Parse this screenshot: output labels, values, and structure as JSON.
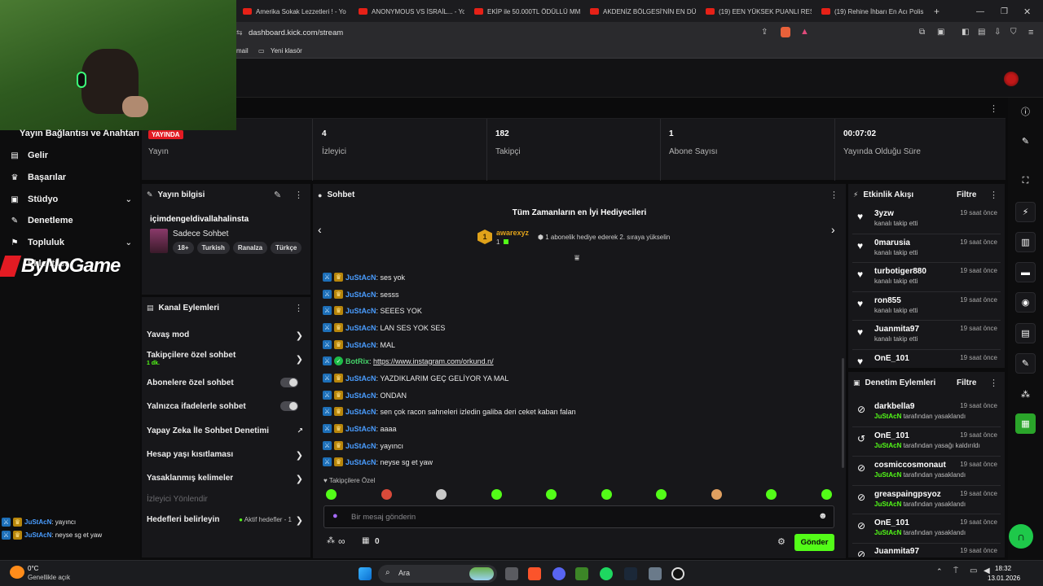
{
  "browser": {
    "tabs": [
      "Amerika Sokak Lezzetleri ! - Yo",
      "ANONYMOUS VS İSRAİL... - Yo",
      "EKİP ile 50.000TL ÖDÜLLÜ MM",
      "AKDENİZ BÖLGESİ'NİN EN DÜ",
      "(19) EEN YÜKSEK PUANLI REST",
      "(19) Rehine İhbarı En Acı Polis"
    ],
    "new_tab": "+",
    "url": "dashboard.kick.com/stream",
    "bookmarks": [
      "mail",
      "Yeni klasör"
    ]
  },
  "overlay": {
    "logo_text": "ByNoGame",
    "partial_heading": "Yayın Bağlantısı ve Anahtarı",
    "chat_lines": [
      {
        "user": "JuStAcN",
        "text": ": yayıncı"
      },
      {
        "user": "JuStAcN",
        "text": ": neyse sg et yaw"
      }
    ]
  },
  "sidebar": {
    "items": [
      {
        "icon": "inbox-icon",
        "label": "Gelir",
        "chevron": false
      },
      {
        "icon": "trophy-icon",
        "label": "Başarılar",
        "chevron": false
      },
      {
        "icon": "studio-icon",
        "label": "Stüdyo",
        "chevron": true
      },
      {
        "icon": "wrench-icon",
        "label": "Denetleme",
        "chevron": false
      },
      {
        "icon": "community-icon",
        "label": "Topluluk",
        "chevron": true
      },
      {
        "icon": "extensions-icon",
        "label": "Eklentiler",
        "chevron": false
      }
    ]
  },
  "stats": {
    "live_badge": "YAYINDA",
    "items": [
      {
        "value": "",
        "label": "Yayın"
      },
      {
        "value": "4",
        "label": "İzleyici"
      },
      {
        "value": "182",
        "label": "Takipçi"
      },
      {
        "value": "1",
        "label": "Abone Sayısı"
      },
      {
        "value": "00:07:02",
        "label": "Yayında Olduğu Süre"
      }
    ]
  },
  "stream_info": {
    "header": "Yayın bilgisi",
    "title": "içimdengeldivallahalinsta",
    "category": "Sadece Sohbet",
    "tags": [
      "18+",
      "Turkish",
      "Ranalza",
      "Türkçe"
    ]
  },
  "channel_actions": {
    "header": "Kanal Eylemleri",
    "slow_mode": "Yavaş mod",
    "followers_only": "Takipçilere özel sohbet",
    "followers_only_sub": "1 dk.",
    "subscribers_only": "Abonelere özel sohbet",
    "emotes_only": "Yalnızca ifadelerle sohbet",
    "ai_moderation": "Yapay Zeka İle Sohbet Denetimi",
    "account_age": "Hesap yaşı kısıtlaması",
    "banned_words": "Yasaklanmış kelimeler",
    "viewer_redirect": "İzleyici Yönlendir",
    "goals": "Hedefleri belirleyin",
    "goals_status": "Aktif hedefler - 1"
  },
  "chat": {
    "header": "Sohbet",
    "gifters_title": "Tüm Zamanların en İyi Hediyecileri",
    "top_gifter": {
      "rank": "1",
      "name": "awarexyz",
      "count": "1"
    },
    "gift_note": "1 abonelik hediye ederek 2. sıraya yükselin",
    "messages": [
      {
        "user": "JuStAcN",
        "text": ": ses yok",
        "bot": false
      },
      {
        "user": "JuStAcN",
        "text": ": sesss",
        "bot": false
      },
      {
        "user": "JuStAcN",
        "text": ": SEEES YOK",
        "bot": false
      },
      {
        "user": "JuStAcN",
        "text": ": LAN SES YOK SES",
        "bot": false
      },
      {
        "user": "JuStAcN",
        "text": ": MAL",
        "bot": false
      },
      {
        "user": "BotRix",
        "text": "https://www.instagram.com/orkund.n/",
        "bot": true
      },
      {
        "user": "JuStAcN",
        "text": ": YAZDIKLARIM GEÇ GELİYOR YA MAL",
        "bot": false
      },
      {
        "user": "JuStAcN",
        "text": ": ONDAN",
        "bot": false
      },
      {
        "user": "JuStAcN",
        "text": ": sen çok racon sahneleri izledin galiba deri ceket kaban falan",
        "bot": false
      },
      {
        "user": "JuStAcN",
        "text": ": aaaa",
        "bot": false
      },
      {
        "user": "JuStAcN",
        "text": ": yayıncı",
        "bot": false
      },
      {
        "user": "JuStAcN",
        "text": ": neyse sg et yaw",
        "bot": false
      }
    ],
    "followers_only_label": "Takipçilere Özel",
    "input_placeholder": "Bir mesaj gönderin",
    "infinity": "∞",
    "point_count": "0",
    "send": "Gönder"
  },
  "activity_feed": {
    "header": "Etkinlik Akışı",
    "filter": "Filtre",
    "items": [
      {
        "name": "3yzw",
        "sub": "kanalı takip etti",
        "time": "19 saat önce"
      },
      {
        "name": "0marusia",
        "sub": "kanalı takip etti",
        "time": "19 saat önce"
      },
      {
        "name": "turbotiger880",
        "sub": "kanalı takip etti",
        "time": "19 saat önce"
      },
      {
        "name": "ron855",
        "sub": "kanalı takip etti",
        "time": "19 saat önce"
      },
      {
        "name": "Juanmita97",
        "sub": "kanalı takip etti",
        "time": "19 saat önce"
      },
      {
        "name": "OnE_101",
        "sub": "",
        "time": "19 saat önce"
      }
    ]
  },
  "mod_actions": {
    "header": "Denetim Eylemleri",
    "filter": "Filtre",
    "items": [
      {
        "name": "darkbella9",
        "by": "JuStAcN",
        "action": " tarafından yasaklandı",
        "time": "19 saat önce",
        "icon": "ban-icon"
      },
      {
        "name": "OnE_101",
        "by": "JuStAcN",
        "action": " tarafından yasağı kaldırıldı",
        "time": "19 saat önce",
        "icon": "undo-icon"
      },
      {
        "name": "cosmiccosmonaut",
        "by": "JuStAcN",
        "action": " tarafından yasaklandı",
        "time": "19 saat önce",
        "icon": "ban-icon"
      },
      {
        "name": "greaspaingpsyoz",
        "by": "JuStAcN",
        "action": " tarafından yasaklandı",
        "time": "19 saat önce",
        "icon": "ban-icon"
      },
      {
        "name": "OnE_101",
        "by": "JuStAcN",
        "action": " tarafından yasaklandı",
        "time": "19 saat önce",
        "icon": "ban-icon"
      },
      {
        "name": "Juanmita97",
        "by": "",
        "action": "",
        "time": "19 saat önce",
        "icon": "ban-icon"
      }
    ]
  },
  "taskbar": {
    "weather_temp": "0°C",
    "weather_desc": "Genellikle açık",
    "search": "Ara",
    "time": "18:32",
    "date": "13.01.2026"
  },
  "colors": {
    "accent": "#53fc18",
    "live": "#e31b23",
    "username": "#4a9dff",
    "panel": "#17171a"
  }
}
